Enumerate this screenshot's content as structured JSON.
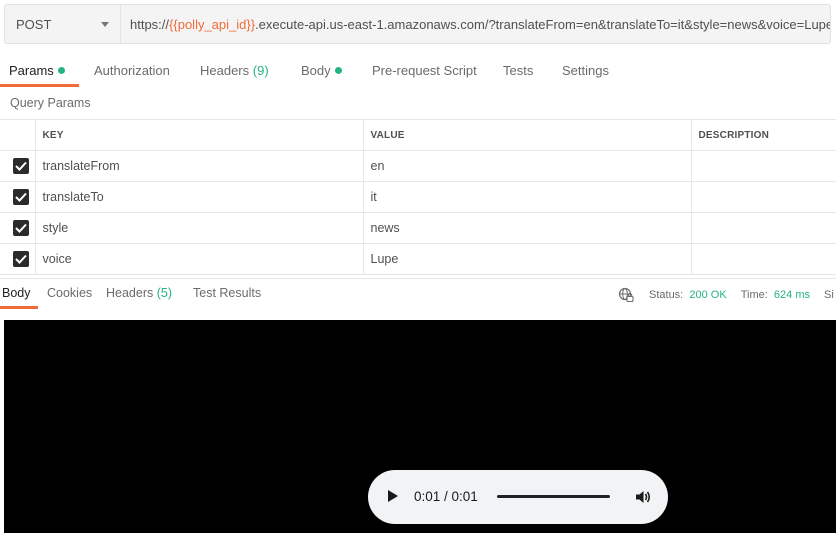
{
  "request": {
    "method": "POST",
    "url_prefix": "https://",
    "url_variable": "{{polly_api_id}}",
    "url_suffix": ".execute-api.us-east-1.amazonaws.com/?translateFrom=en&translateTo=it&style=news&voice=Lupe"
  },
  "request_tabs": {
    "params": "Params",
    "authorization": "Authorization",
    "headers": "Headers",
    "headers_count": "(9)",
    "body": "Body",
    "prerequest": "Pre-request Script",
    "tests": "Tests",
    "settings": "Settings"
  },
  "query_params": {
    "title": "Query Params",
    "columns": {
      "key": "KEY",
      "value": "VALUE",
      "description": "DESCRIPTION"
    },
    "rows": [
      {
        "key": "translateFrom",
        "value": "en",
        "description": "",
        "checked": true
      },
      {
        "key": "translateTo",
        "value": "it",
        "description": "",
        "checked": true
      },
      {
        "key": "style",
        "value": "news",
        "description": "",
        "checked": true
      },
      {
        "key": "voice",
        "value": "Lupe",
        "description": "",
        "checked": true
      }
    ]
  },
  "response_tabs": {
    "body": "Body",
    "cookies": "Cookies",
    "headers": "Headers",
    "headers_count": "(5)",
    "test_results": "Test Results"
  },
  "response_status": {
    "status_label": "Status:",
    "status_value": "200 OK",
    "time_label": "Time:",
    "time_value": "624 ms",
    "size_label_partial": "Si"
  },
  "audio_player": {
    "time": "0:01 / 0:01",
    "progress": 1.0
  },
  "colors": {
    "accent": "#f26b3a",
    "success": "#26b47f",
    "media_background": "#000000"
  }
}
